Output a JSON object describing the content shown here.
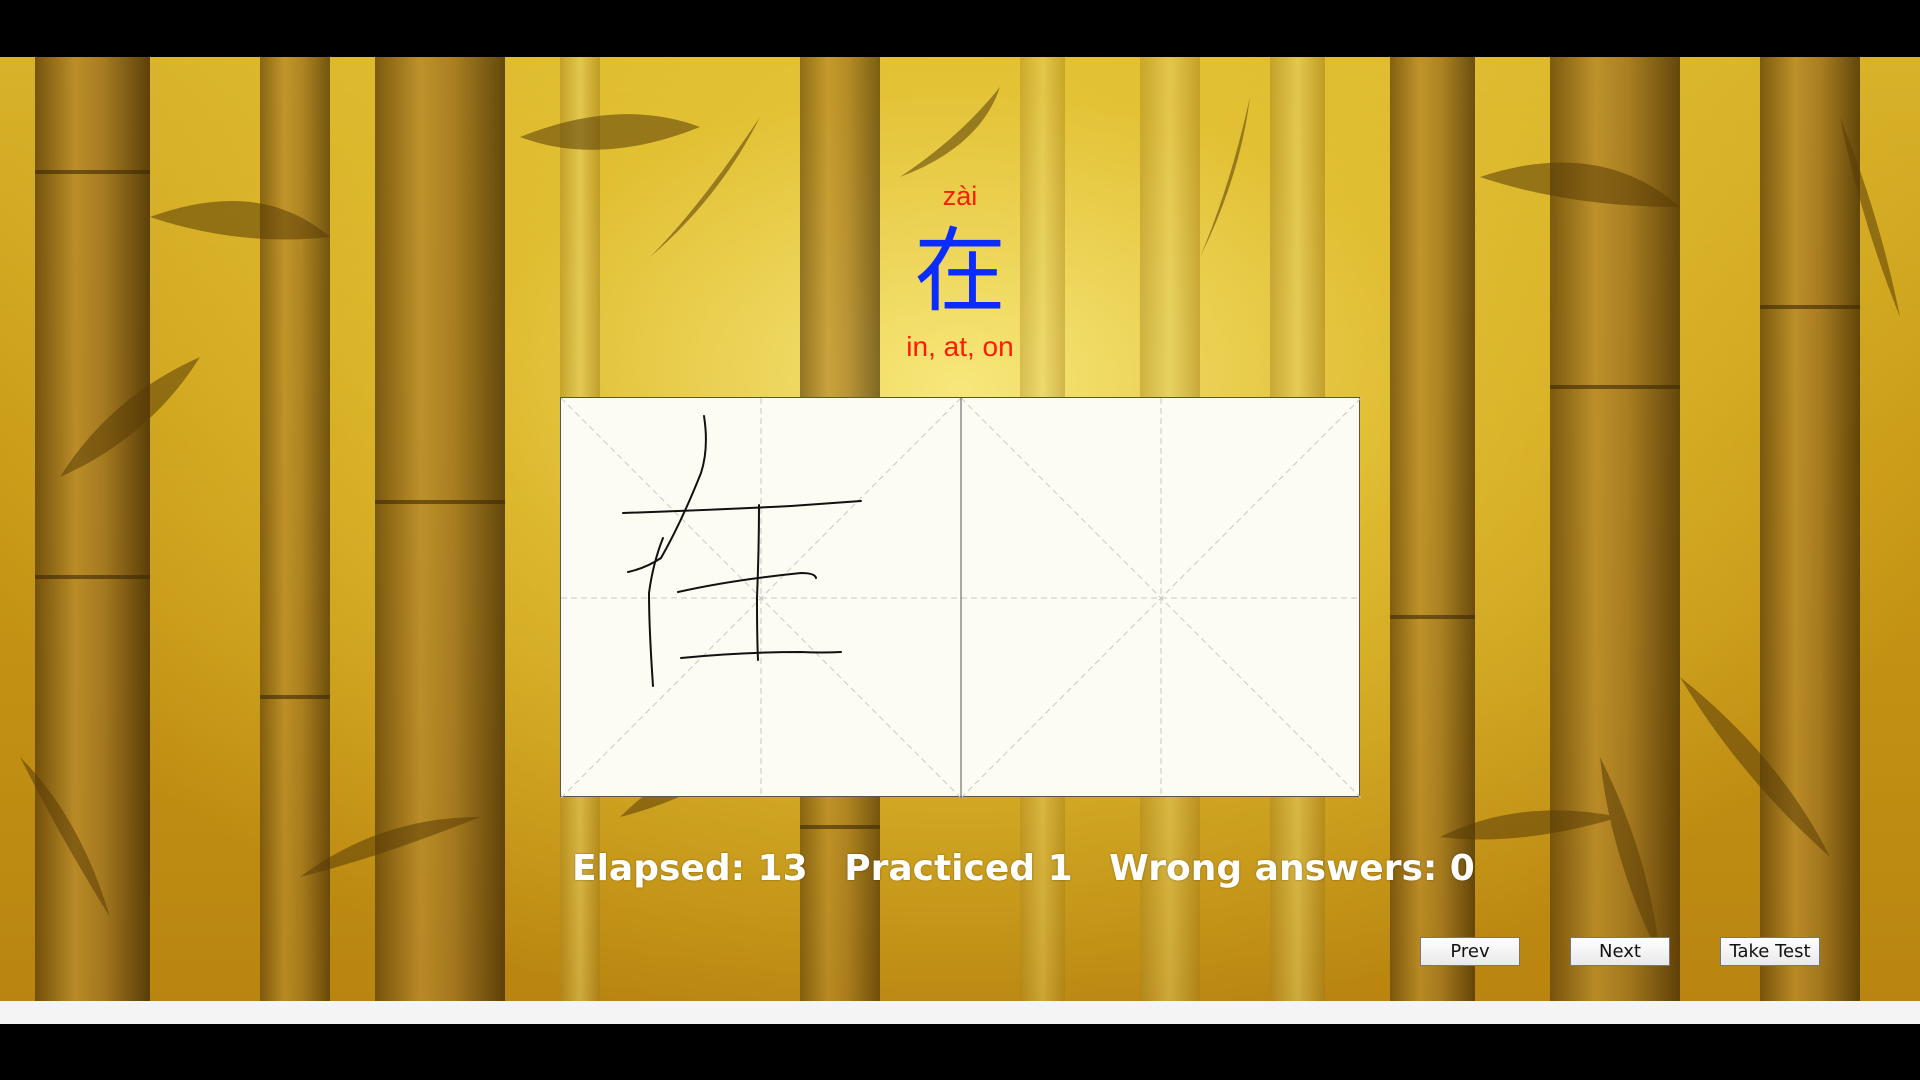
{
  "card": {
    "pinyin": "zài",
    "character": "在",
    "meaning": "in, at, on"
  },
  "stats": {
    "elapsed": "Elapsed: 13",
    "practiced": "Practiced 1",
    "wrong": "Wrong answers: 0"
  },
  "buttons": {
    "prev": "Prev",
    "next": "Next",
    "test": "Take Test"
  },
  "colors": {
    "pinyin": "#ff1a00",
    "character": "#0a2cff",
    "meaning": "#ff1a00",
    "stats": "#ffffff",
    "background": "#c99a16"
  }
}
